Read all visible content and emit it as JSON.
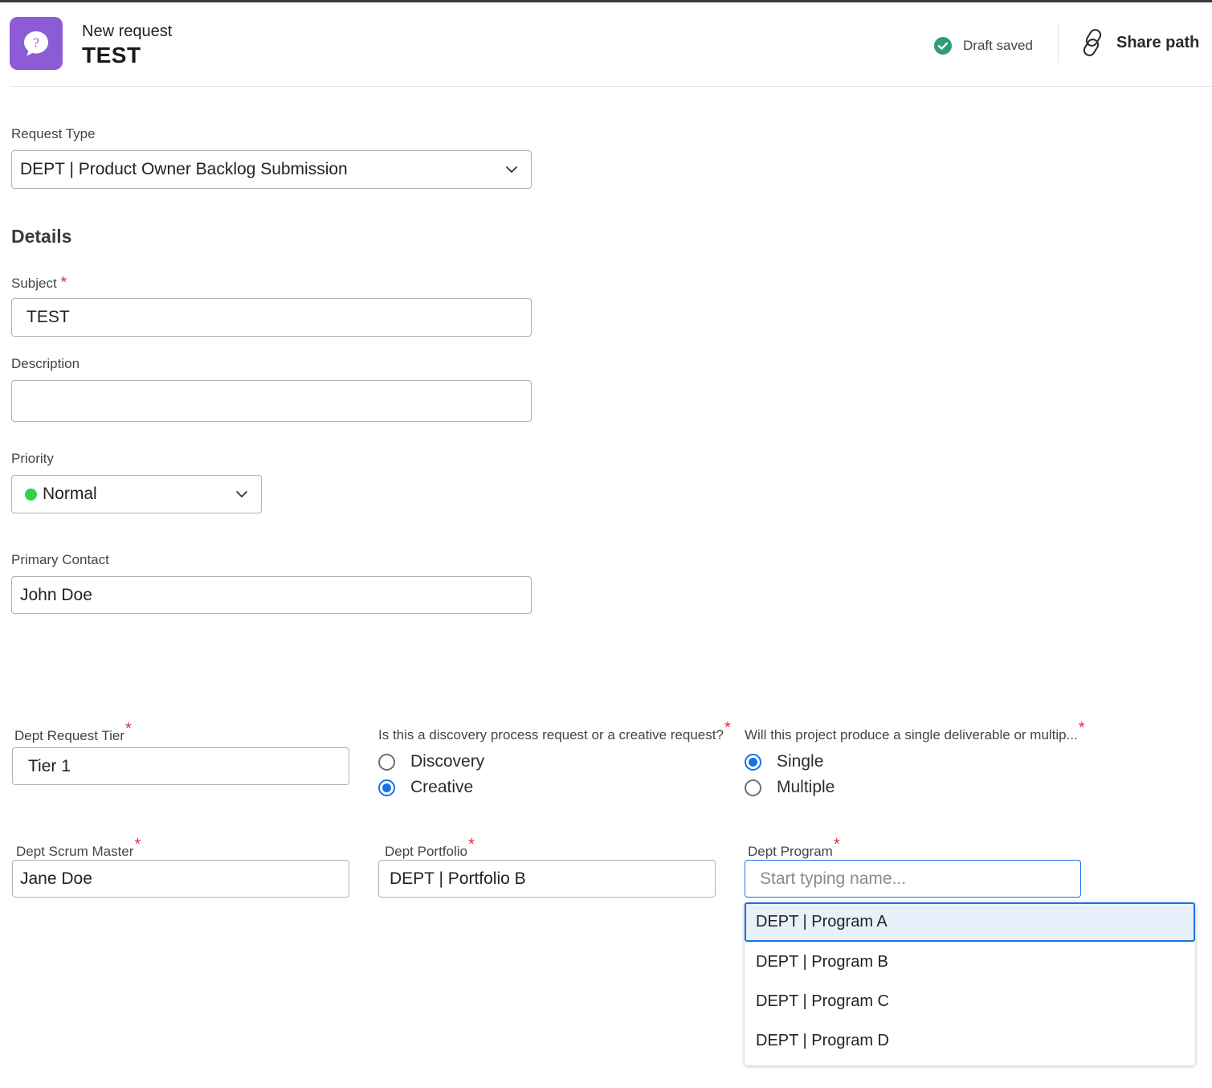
{
  "header": {
    "subtitle": "New request",
    "title": "TEST",
    "app_icon": "help-chat-icon",
    "status_text": "Draft saved",
    "status_icon": "check-circle-icon",
    "share_label": "Share path",
    "share_icon": "link-icon"
  },
  "form": {
    "request_type": {
      "label": "Request Type",
      "value": "DEPT | Product Owner Backlog Submission"
    },
    "details_title": "Details",
    "subject": {
      "label": "Subject",
      "required_mark": "*",
      "value": "TEST"
    },
    "description": {
      "label": "Description",
      "value": ""
    },
    "priority": {
      "label": "Priority",
      "value": "Normal",
      "dot_color": "#2fd14a"
    },
    "primary_contact": {
      "label": "Primary Contact",
      "value": "John Doe"
    },
    "tier": {
      "label": "Dept Request Tier",
      "required_mark": "*",
      "value": "Tier 1"
    },
    "discovery_question": {
      "label": "Is this a discovery process request or a creative request?",
      "required_mark": "*",
      "options": [
        "Discovery",
        "Creative"
      ],
      "selected": "Creative"
    },
    "deliverable_question": {
      "label": "Will this project produce a single deliverable or multip...",
      "required_mark": "*",
      "options": [
        "Single",
        "Multiple"
      ],
      "selected": "Single"
    },
    "scrum_master": {
      "label": "Dept Scrum Master",
      "required_mark": "*",
      "value": "Jane Doe"
    },
    "portfolio": {
      "label": "Dept Portfolio",
      "required_mark": "*",
      "value": "DEPT | Portfolio B"
    },
    "program": {
      "label": "Dept Program",
      "required_mark": "*",
      "placeholder": "Start typing name...",
      "options": [
        "DEPT | Program A",
        "DEPT | Program B",
        "DEPT | Program C",
        "DEPT | Program D"
      ],
      "highlighted": "DEPT | Program A"
    }
  },
  "colors": {
    "accent": "#1473e6",
    "required": "#d7373f",
    "brand": "#8b5cd6",
    "success": "#2d9d78"
  }
}
